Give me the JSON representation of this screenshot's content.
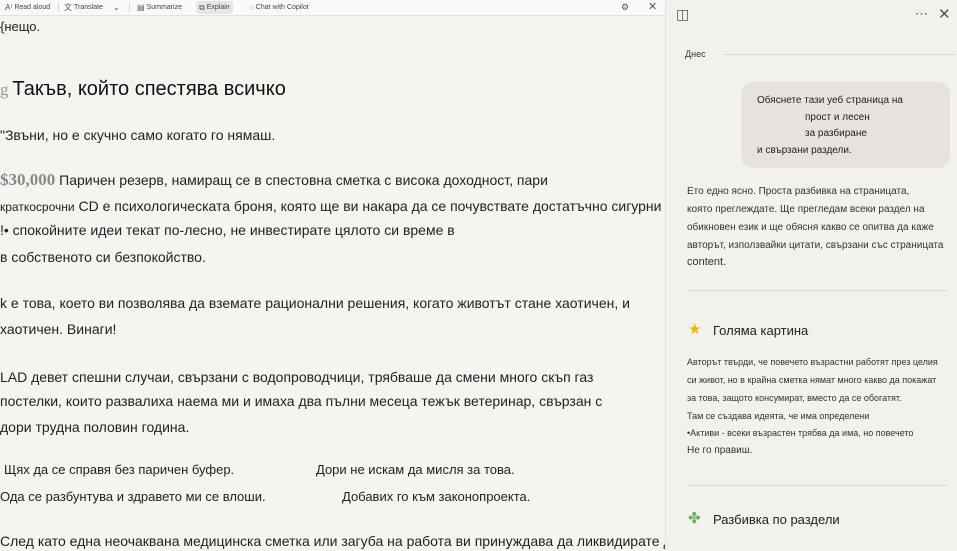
{
  "toolbar": {
    "read_aloud": "Read aloud",
    "translate": "Translate",
    "summarize": "Summarize",
    "explain": "Explain",
    "chat": "Chat with Copilot"
  },
  "article": {
    "intro": "{нещо.",
    "heading_prefix": "g",
    "heading": "Такъв, който спестява всичко",
    "quote": "\"Звъни, но е скучно само когато го нямаш.",
    "amount": "$30,000",
    "p1_l1": "Паричен резерв, намиращ се в спестовна сметка с висока доходност, пари",
    "p1_l2a": "краткосрочни",
    "p1_l2b": "CD е психологическата броня, която ще ви накара да се почувствате достатъчно сигурни",
    "p1_l3": "!• спокойните идеи текат по-лесно, не инвестирате цялото си време в",
    "p1_l4": "в собственото си безпокойство.",
    "p2_l1": "k е това, което ви позволява да вземате рационални решения, когато животът стане хаотичен, и",
    "p2_l2": "хаотичен. Винаги!",
    "p3_l1": "LAD девет спешни случаи, свързани с водопроводчици, трябваше да смени много скъп газ",
    "p3_l2": "постелки, които развалиха наема ми и имаха два пълни месеца тежък ветеринар, свързан с",
    "p3_l3": "дори трудна половин година.",
    "c1a": "Щях да се справя без паричен буфер.",
    "c1b": "Дори не искам да мисля за това.",
    "c2a": "Ода се разбунтува и здравето ми се влоши.",
    "c2b": "Добавих го към законопроекта.",
    "last": "След като една неочаквана медицинска сметка или загуба на работа ви принуждава да ликвидирате дългогодишния си"
  },
  "panel": {
    "today": "Днес",
    "user_msg": [
      "Обяснете тази уеб страница на",
      "прост и лесен",
      "за разбиране",
      "и свързани раздели."
    ],
    "response": [
      "Ето едно ясно. Проста разбивка на страницата,",
      "която преглеждате. Ще прегледам всеки раздел на",
      "обикновен език и ще обясня какво се опитва да каже",
      "авторът, използвайки цитати, свързани със страницата",
      "content."
    ],
    "section1_title": "Голяма картина",
    "section1_icon": "star-icon",
    "section1_body": [
      "Авторът твърди, че повечето възрастни работят през целия",
      "си живот, но в крайна сметка нямат много какво да покажат",
      "за това, защото консумират, вместо да се обогатят.",
      "Там се създава идеята, че има определени",
      "•Активи - всеки възрастен трябва да има, но повечето",
      "Не го правиш."
    ],
    "section2_title": "Разбивка по раздели",
    "section2_icon": "puzzle-icon"
  },
  "colors": {
    "article_bg": "#f6f4f0",
    "panel_bg": "#f3f1ee",
    "bubble_bg": "#e6e3de",
    "star": "#f2b705",
    "puzzle": "#5fb35f"
  }
}
